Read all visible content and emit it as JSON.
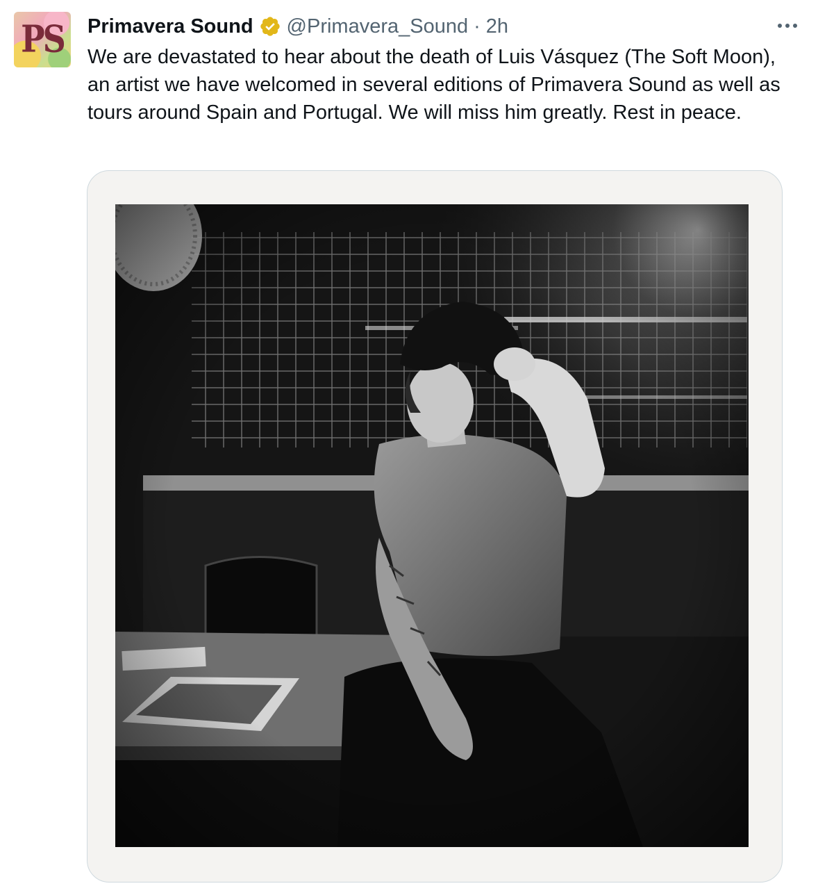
{
  "tweet": {
    "avatar_text": "PS",
    "display_name": "Primavera Sound",
    "handle": "@Primavera_Sound",
    "separator": "·",
    "time": "2h",
    "text": "We are devastated to hear about the death of Luis Vásquez (The Soft Moon), an artist we have welcomed in several editions of Primavera Sound as well as tours around Spain and Portugal. We will miss him greatly. Rest in peace.",
    "verified_icon": "gold-verified-badge-icon",
    "more_icon": "more-options-icon"
  },
  "colors": {
    "text_primary": "#0f1419",
    "text_secondary": "#536471",
    "verified_gold": "#e2b719",
    "card_border": "#cfd9de",
    "photo_frame": "#f4f3f1"
  }
}
